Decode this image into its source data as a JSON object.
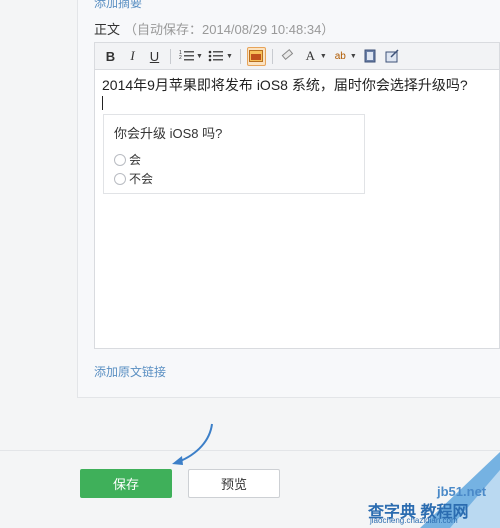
{
  "summary": {
    "add_label": "添加摘要"
  },
  "body": {
    "label": "正文",
    "autosave": "（自动保存：2014/08/29 10:48:34）"
  },
  "toolbar": {
    "bold": "B",
    "italic": "I",
    "underline": "U",
    "icons": [
      "bold-icon",
      "italic-icon",
      "underline-icon",
      "ordered-list-icon",
      "unordered-list-icon",
      "image-icon",
      "eraser-icon",
      "font-color-icon",
      "highlight-icon",
      "video-icon",
      "poll-icon"
    ],
    "font_color": "A",
    "highlight": "ab"
  },
  "editor": {
    "line1": "2014年9月苹果即将发布 iOS8 系统，届时你会选择升级吗?",
    "poll": {
      "question": "你会升级 iOS8 吗?",
      "options": [
        "会",
        "不会"
      ]
    }
  },
  "original_link": {
    "label": "添加原文链接"
  },
  "actions": {
    "save": "保存",
    "preview": "预览"
  },
  "colors": {
    "save": "#3fb05a",
    "link": "#5a8fc2",
    "arrow": "#3c7fc8"
  },
  "watermark": {
    "site": "jb51.net",
    "big": "查字典 教程网",
    "url": "jiaocheng.chazidian.com"
  }
}
